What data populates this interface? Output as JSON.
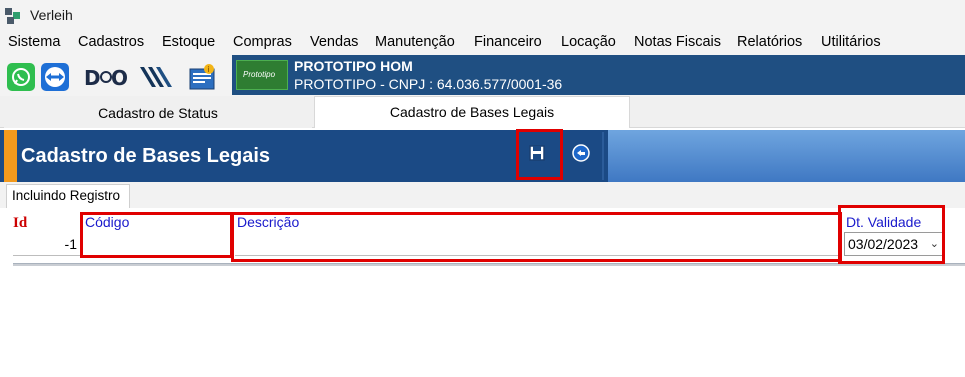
{
  "window": {
    "title": "Verleih"
  },
  "menu": [
    "Sistema",
    "Cadastros",
    "Estoque",
    "Compras",
    "Vendas",
    "Manutenção",
    "Financeiro",
    "Locação",
    "Notas Fiscais",
    "Relatórios",
    "Utilitários"
  ],
  "toolbar_icons": [
    "whatsapp-icon",
    "teamviewer-icon",
    "dxo-logo-icon",
    "striped-logo-icon",
    "notification-document-icon"
  ],
  "company": {
    "logo_text": "Prototipo",
    "name": "PROTOTIPO HOM",
    "cnpj_line": "PROTOTIPO - CNPJ : 64.036.577/0001-36"
  },
  "tabs": [
    "Cadastro de Status",
    "Cadastro de Bases Legais"
  ],
  "active_tab": "Cadastro de Bases Legais",
  "page_header": {
    "title": "Cadastro de Bases Legais",
    "save_icon": "save-icon",
    "back_icon": "back-icon"
  },
  "subtab": "Incluindo Registro",
  "form": {
    "id_label": "Id",
    "id_value": "-1",
    "codigo_label": "Código",
    "codigo_value": "",
    "descricao_label": "Descrição",
    "descricao_value": "",
    "validade_label": "Dt. Validade",
    "validade_value": "03/02/2023"
  },
  "colors": {
    "header_blue": "#1b4a85",
    "accent_orange": "#f39a1d",
    "highlight_red": "#e00000",
    "label_blue": "#1a1acc",
    "label_red": "#cc0000"
  }
}
